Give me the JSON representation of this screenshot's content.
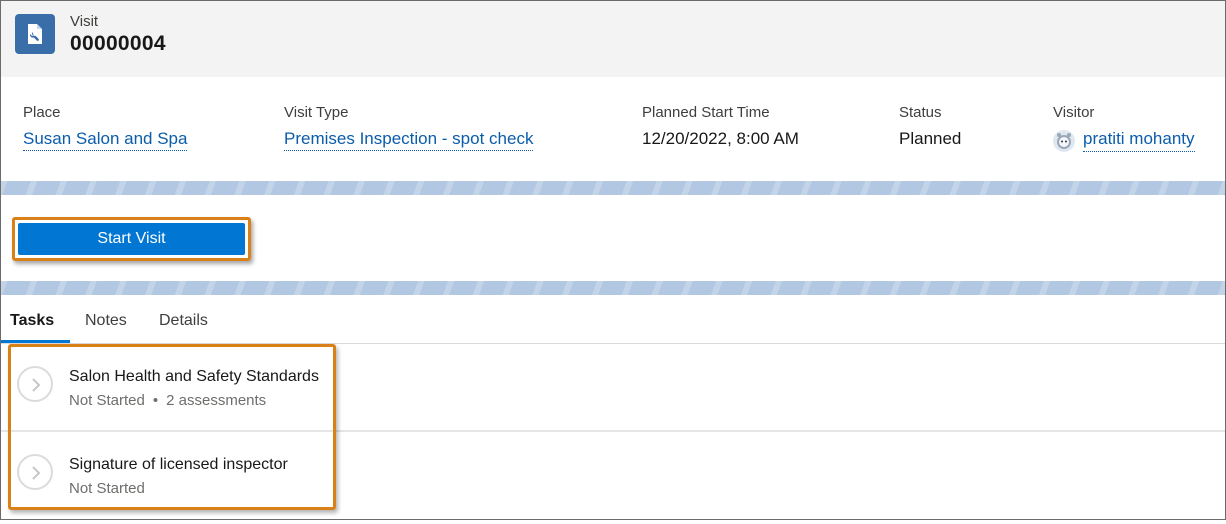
{
  "header": {
    "object_label": "Visit",
    "record_name": "00000004",
    "icon": "wrench-document-icon",
    "icon_color": "#3a6ea8"
  },
  "fields": [
    {
      "label": "Place",
      "value": "Susan Salon and Spa",
      "is_link": true
    },
    {
      "label": "Visit Type",
      "value": "Premises Inspection - spot check",
      "is_link": true
    },
    {
      "label": "Planned Start Time",
      "value": "12/20/2022, 8:00 AM",
      "is_link": false
    },
    {
      "label": "Status",
      "value": "Planned",
      "is_link": false
    },
    {
      "label": "Visitor",
      "value": "pratiti mohanty",
      "is_link": true,
      "icon": "astro-avatar-icon"
    }
  ],
  "actions": {
    "start_visit_label": "Start Visit",
    "button_color": "#0176d3",
    "highlight_color": "#d98118"
  },
  "tabs": [
    {
      "label": "Tasks",
      "active": true
    },
    {
      "label": "Notes",
      "active": false
    },
    {
      "label": "Details",
      "active": false
    }
  ],
  "tasks": [
    {
      "title": "Salon Health and Safety Standards",
      "status": "Not Started",
      "extra": "2 assessments",
      "separator": "•"
    },
    {
      "title": "Signature of licensed inspector",
      "status": "Not Started"
    }
  ],
  "colors": {
    "link": "#0b5cab",
    "band": "#b2c7e2",
    "header_bg": "#f3f3f3"
  }
}
